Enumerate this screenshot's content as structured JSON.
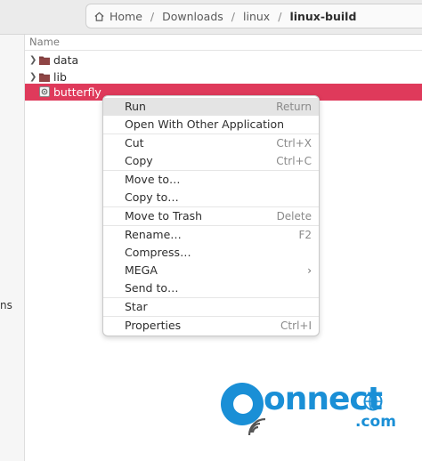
{
  "breadcrumb": {
    "items": [
      "Home",
      "Downloads",
      "linux",
      "linux-build"
    ],
    "separator": "/"
  },
  "sidebar": {
    "fragment": "ns"
  },
  "list": {
    "column_header": "Name",
    "rows": [
      {
        "label": "data",
        "type": "folder"
      },
      {
        "label": "lib",
        "type": "folder"
      },
      {
        "label": "butterfly",
        "type": "executable",
        "selected": true
      }
    ]
  },
  "context_menu": {
    "items": [
      {
        "label": "Run",
        "accel": "Return",
        "highlighted": true
      },
      {
        "label": "Open With Other Application",
        "accel": ""
      },
      {
        "label": "Cut",
        "accel": "Ctrl+X"
      },
      {
        "label": "Copy",
        "accel": "Ctrl+C"
      },
      {
        "label": "Move to…",
        "accel": ""
      },
      {
        "label": "Copy to…",
        "accel": ""
      },
      {
        "label": "Move to Trash",
        "accel": "Delete"
      },
      {
        "label": "Rename…",
        "accel": "F2"
      },
      {
        "label": "Compress…",
        "accel": ""
      },
      {
        "label": "MEGA",
        "accel": "",
        "submenu": true
      },
      {
        "label": "Send to…",
        "accel": ""
      },
      {
        "label": "Star",
        "accel": ""
      },
      {
        "label": "Properties",
        "accel": "Ctrl+I"
      }
    ]
  },
  "watermark": {
    "brand": "onnect",
    "suffix": ".com"
  },
  "colors": {
    "selection": "#df3a5b",
    "folder": "#7a3b3b",
    "watermark": "#1a8fd6"
  }
}
